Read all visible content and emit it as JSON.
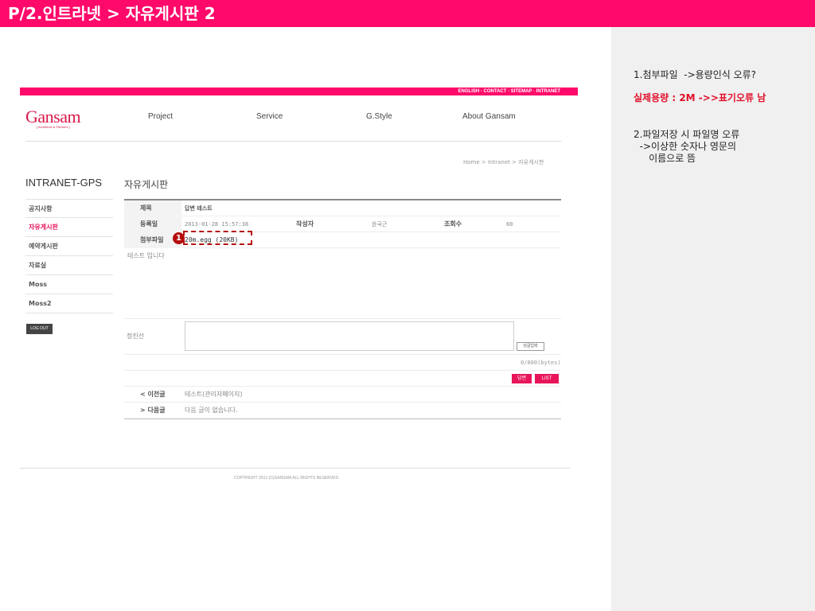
{
  "slide": {
    "title": "P/2.인트라넷 > 자유게시판 2"
  },
  "notes": {
    "line1": "1.첨부파일  ->용량인식 오류?",
    "line1_highlight": "실제용량 : 2M ->>표기오류 남",
    "line2": "2.파일저장 시 파일명 오류\n  ->이상한 숫자나 영문의\n     이름으로 뜸"
  },
  "site": {
    "util_links": "ENGLISH · CONTACT · SITEMAP · INTRANET",
    "logo": "Gansam",
    "logo_sub": "[ Architects & Partners ]",
    "gnb": [
      "Project",
      "Service",
      "G.Style",
      "About Gansam"
    ],
    "breadcrumb": "Home > Intranet > 자유게시판"
  },
  "sidebar": {
    "title": "INTRANET-GPS",
    "items": [
      "공지사항",
      "자유게시판",
      "예약게시판",
      "자료실",
      "Moss",
      "Moss2"
    ],
    "logout_label": "LOG OUT"
  },
  "board": {
    "title": "자유게시판",
    "subject_label": "제목",
    "subject_value": "답변 테스트",
    "date_label": "등록일",
    "date_value": "2013-01-28 15:57:38",
    "author_label": "작성자",
    "author_value": "윤국근",
    "views_label": "조회수",
    "views_value": "60",
    "attach_label": "첨부파일",
    "attach_value": "20m.egg (20KB)",
    "content": "테스트 입니다",
    "marker": "1"
  },
  "comment": {
    "label": "정진선",
    "button_label": "덧글입력",
    "bytes": "0/800(bytes)"
  },
  "actions": {
    "reply_label": "답변",
    "list_label": "LIST"
  },
  "nav": {
    "prev_label": "< 이전글",
    "prev_value": "테스트(관리자페이지)",
    "next_label": "> 다음글",
    "next_value": "다음 글이 없습니다."
  },
  "footer": {
    "copyright": "COPYRIGHT 2012 (C)GANSAM ALL RIGHTS RESERVED."
  },
  "colors": {
    "brand": "#ff0a6a",
    "annotation_red": "#b50d0d"
  }
}
